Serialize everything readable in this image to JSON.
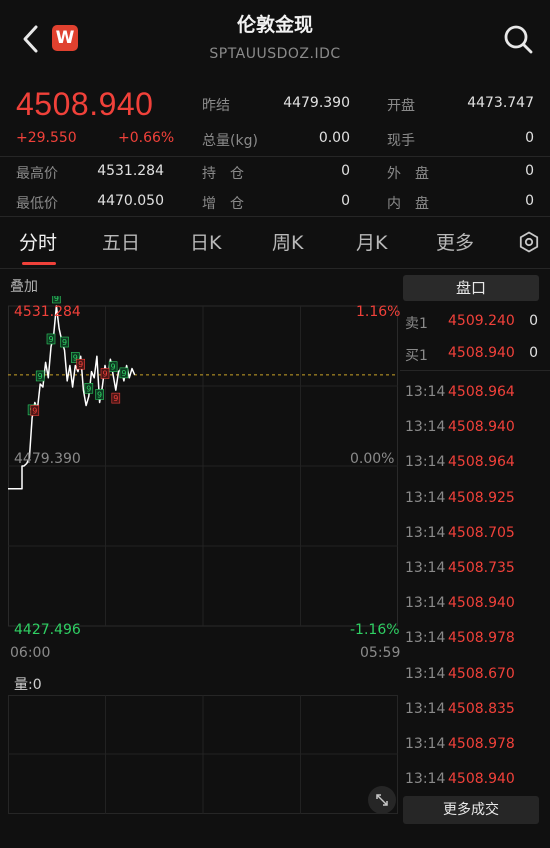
{
  "header": {
    "title": "伦敦金现",
    "subtitle": "SPTAUUSDOZ.IDC",
    "logo_letter": "W"
  },
  "quote": {
    "price": "4508.940",
    "change": "+29.550",
    "change_pct": "+0.66%",
    "stats": [
      {
        "label": "昨结",
        "value": "4479.390"
      },
      {
        "label": "开盘",
        "value": "4473.747"
      },
      {
        "label": "总量(kg)",
        "value": "0.00"
      },
      {
        "label": "现手",
        "value": "0"
      },
      {
        "label": "最高价",
        "value": "4531.284"
      },
      {
        "label": "持　仓",
        "value": "0"
      },
      {
        "label": "外　盘",
        "value": "0"
      },
      {
        "label": "最低价",
        "value": "4470.050"
      },
      {
        "label": "增　仓",
        "value": "0"
      },
      {
        "label": "内　盘",
        "value": "0"
      }
    ]
  },
  "tabs": [
    {
      "label": "分时"
    },
    {
      "label": "五日"
    },
    {
      "label": "日K"
    },
    {
      "label": "周K"
    },
    {
      "label": "月K"
    },
    {
      "label": "更多"
    }
  ],
  "chart": {
    "overlay_label": "叠加",
    "high_label": "4531.284",
    "high_pct": "1.16%",
    "mid_label": "4479.390",
    "mid_pct": "0.00%",
    "low_label": "4427.496",
    "low_pct": "-1.16%",
    "time_start": "06:00",
    "time_end": "05:59",
    "volume_label": "量:0",
    "marker_glyph": "9",
    "colors": {
      "up": "#f0413a",
      "down": "#2fcf63",
      "line": "#ffffff",
      "avg": "#c9a227"
    }
  },
  "chart_data": {
    "type": "line",
    "title": "",
    "xlabel": "",
    "ylabel": "",
    "x": [
      "06:00",
      "05:59"
    ],
    "ylim": [
      4427.496,
      4531.284
    ],
    "reference": 4479.39,
    "current": 4508.94,
    "series": [
      {
        "values": [
          4479.4,
          4480.2,
          4482.0,
          4495.0,
          4500.0,
          4498.0,
          4506.0,
          4505.0,
          4513.0,
          4508.0,
          4518.0,
          4522.0,
          4531.284,
          4524.0,
          4520.0,
          4517.0,
          4507.0,
          4512.0,
          4505.0,
          4512.0,
          4510.0,
          4515.0,
          4504.0,
          4499.0,
          4502.0,
          4510.0,
          4508.0,
          4515.0,
          4500.0,
          4505.0,
          4512.0,
          4508.0,
          4514.0,
          4509.0,
          4504.0,
          4510.0,
          4511.0,
          4507.0,
          4512.0,
          4508.0,
          4511.0,
          4508.94
        ]
      }
    ]
  },
  "panel": {
    "title": "盘口",
    "order_book": [
      {
        "label": "卖1",
        "price": "4509.240",
        "vol": "0"
      },
      {
        "label": "买1",
        "price": "4508.940",
        "vol": "0"
      }
    ],
    "trades": [
      {
        "time": "13:14",
        "price": "4508.964"
      },
      {
        "time": "13:14",
        "price": "4508.940"
      },
      {
        "time": "13:14",
        "price": "4508.964"
      },
      {
        "time": "13:14",
        "price": "4508.925"
      },
      {
        "time": "13:14",
        "price": "4508.705"
      },
      {
        "time": "13:14",
        "price": "4508.735"
      },
      {
        "time": "13:14",
        "price": "4508.940"
      },
      {
        "time": "13:14",
        "price": "4508.978"
      },
      {
        "time": "13:14",
        "price": "4508.670"
      },
      {
        "time": "13:14",
        "price": "4508.835"
      },
      {
        "time": "13:14",
        "price": "4508.978"
      },
      {
        "time": "13:14",
        "price": "4508.940"
      }
    ],
    "more_trades": "更多成交"
  }
}
